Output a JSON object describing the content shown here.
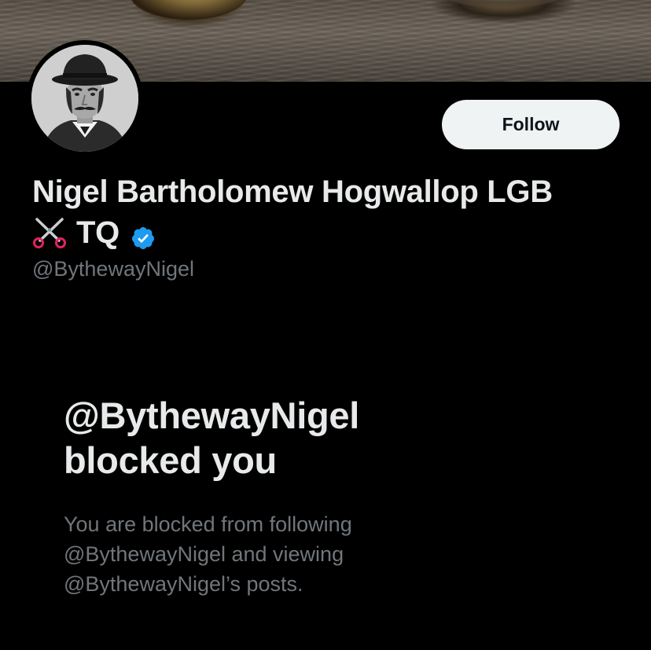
{
  "profile": {
    "display_name_line1": "Nigel Bartholomew Hogwallop LGB",
    "display_name_line2": "TQ",
    "handle": "@BythewayNigel",
    "verified": true,
    "icons": [
      "scissors-icon",
      "verified-badge-icon"
    ],
    "accent_color": "#1d9bf0"
  },
  "actions": {
    "follow_label": "Follow"
  },
  "blocked_notice": {
    "title_line1": "@BythewayNigel",
    "title_line2": "blocked you",
    "description_line1": "You are blocked from following",
    "description_line2": "@BythewayNigel and viewing",
    "description_line3": "@BythewayNigel’s posts."
  }
}
